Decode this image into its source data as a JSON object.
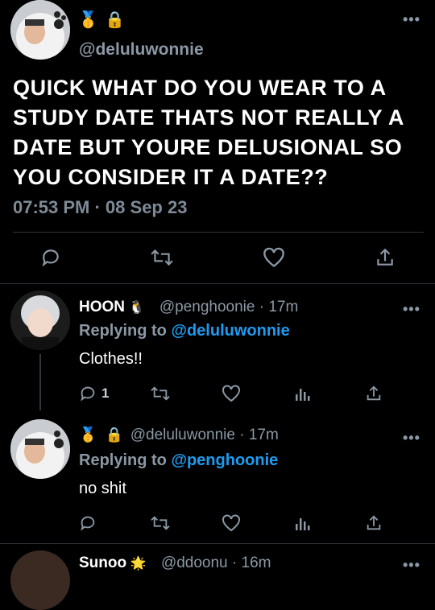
{
  "main_tweet": {
    "badges": [
      "🥇",
      "🔒"
    ],
    "handle": "@deluluwonnie",
    "text": "QUICK WHAT DO YOU WEAR TO A STUDY DATE THATS NOT REALLY A DATE BUT YOURE DELUSIONAL SO YOU CONSIDER IT A DATE??",
    "timestamp": "07:53 PM · 08 Sep 23",
    "more_label": "•••"
  },
  "replies": [
    {
      "name": "HOON",
      "name_emoji": "🐧",
      "handle_time": "@penghoonie · 17m",
      "replying_prefix": "Replying to ",
      "replying_to": "@deluluwonnie",
      "text": "Clothes!!",
      "reply_count": "1",
      "more_label": "•••"
    },
    {
      "badges": [
        "🥇",
        "🔒"
      ],
      "handle_time": "@deluluwonnie · 17m",
      "replying_prefix": "Replying to ",
      "replying_to": "@penghoonie",
      "text": "no shit",
      "more_label": "•••"
    },
    {
      "name": "Sunoo",
      "name_emoji": "🌟",
      "handle_time": "@ddoonu · 16m",
      "more_label": "•••"
    }
  ],
  "icons": {
    "reply": "reply-icon",
    "retweet": "retweet-icon",
    "like": "heart-icon",
    "views": "views-icon",
    "share": "share-icon"
  },
  "colors": {
    "background": "#000000",
    "text": "#ffffff",
    "muted": "#8b98a5",
    "link": "#1d9bf0",
    "divider": "#2f3336"
  }
}
